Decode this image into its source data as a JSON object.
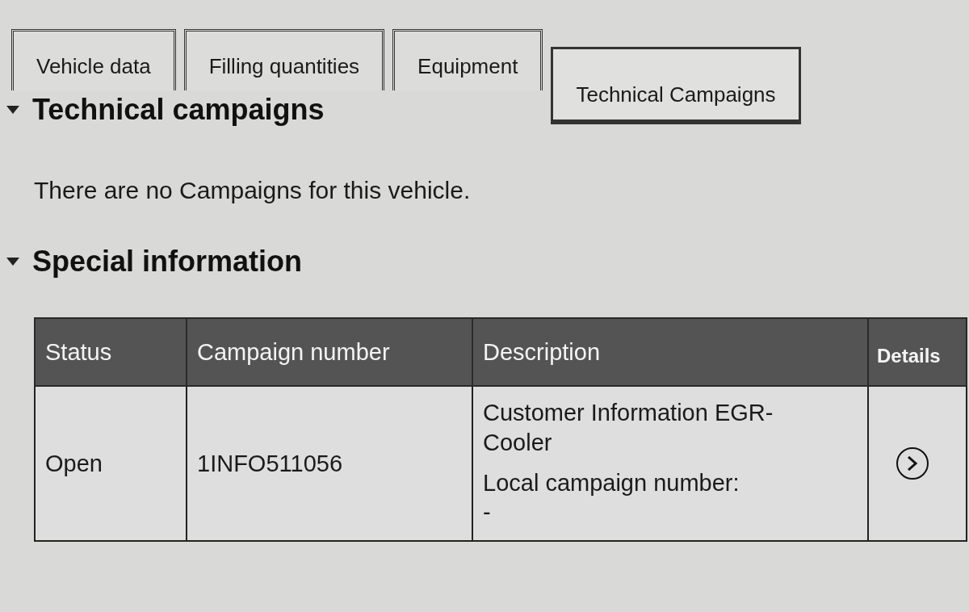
{
  "tabs": [
    {
      "label": "Vehicle data",
      "selected": false
    },
    {
      "label": "Filling quantities",
      "selected": false
    },
    {
      "label": "Equipment",
      "selected": false
    },
    {
      "label": "Technical Campaigns",
      "selected": true
    }
  ],
  "sections": [
    {
      "title": "Technical campaigns",
      "expanded": true,
      "message": "There are no Campaigns for this vehicle."
    },
    {
      "title": "Special information",
      "expanded": true,
      "table": {
        "columns": [
          "Status",
          "Campaign number",
          "Description",
          "Details"
        ],
        "rows": [
          {
            "status": "Open",
            "campaign_number": "1INFO511056",
            "description": "Customer Information EGR-Cooler",
            "local_campaign_label": "Local campaign number:",
            "local_campaign_number": "-"
          }
        ]
      }
    }
  ]
}
